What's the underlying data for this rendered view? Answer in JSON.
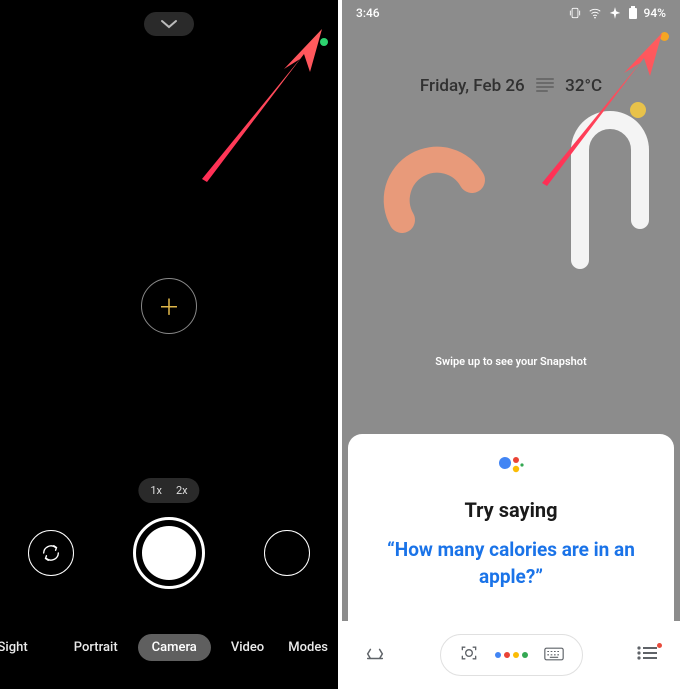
{
  "left": {
    "privacy_indicator_color": "#2dd36f",
    "zoom": {
      "opt1": "1x",
      "opt2": "2x"
    },
    "modes": {
      "edge_left": "t Sight",
      "portrait": "Portrait",
      "camera": "Camera",
      "video": "Video",
      "edge_right": "Modes"
    }
  },
  "right": {
    "status": {
      "time": "3:46",
      "battery": "94%"
    },
    "privacy_indicator_color": "#f5a623",
    "weather": {
      "date": "Friday, Feb 26",
      "temp": "32°C"
    },
    "swipe_hint": "Swipe up to see your Snapshot",
    "assistant": {
      "heading": "Try saying",
      "suggestion": "“How many calories are in an apple?”"
    }
  }
}
